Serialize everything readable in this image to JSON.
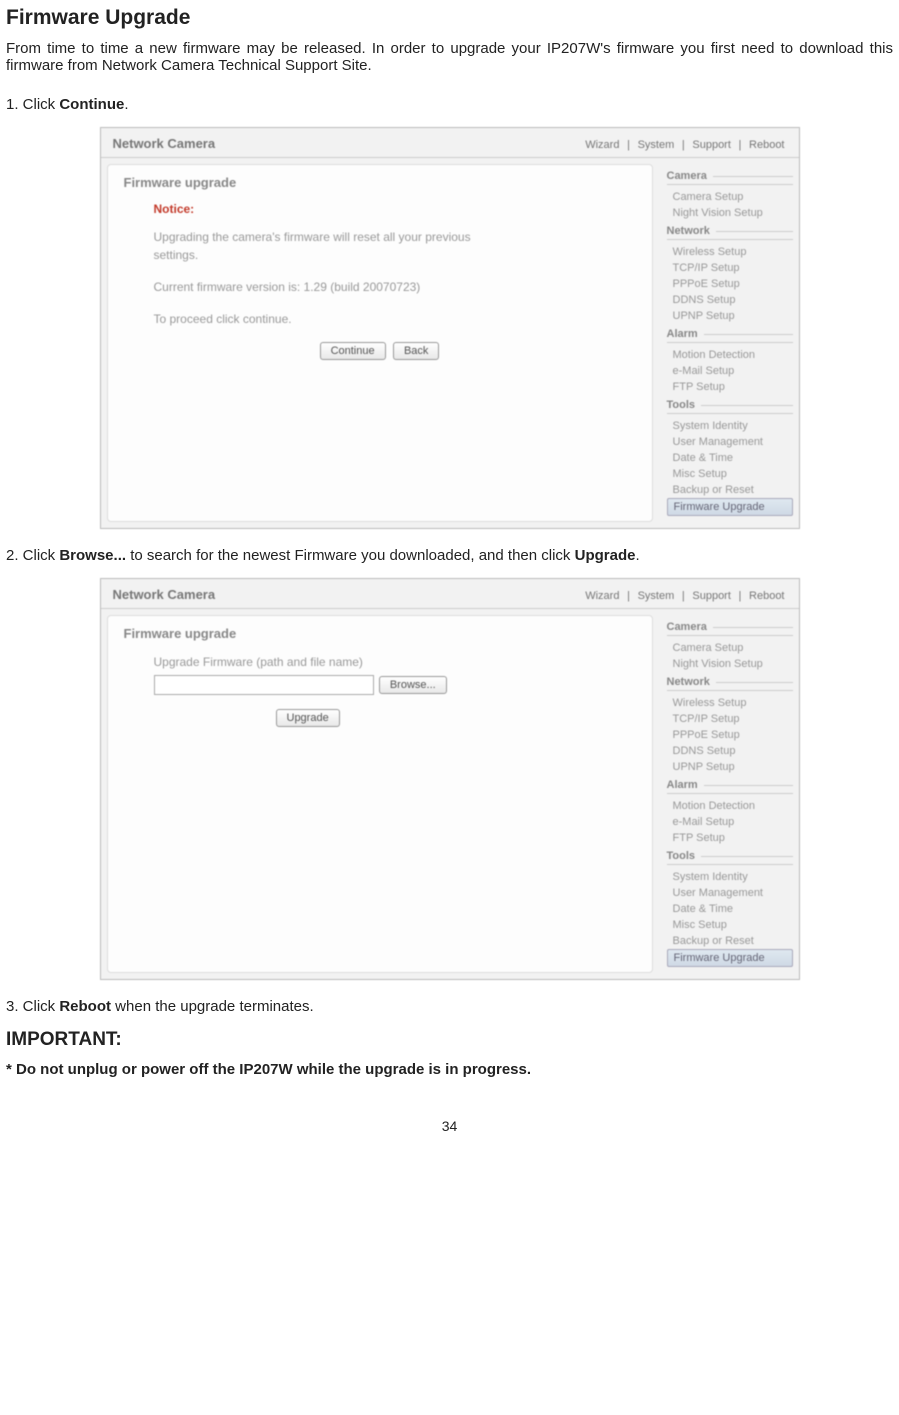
{
  "heading": "Firmware Upgrade",
  "intro": "From time to time a new firmware may be released. In order to upgrade your IP207W's firmware you first need to download this firmware from Network Camera Technical Support Site.",
  "step1_prefix": "1. Click ",
  "step1_bold": "Continue",
  "step1_suffix": ".",
  "step2_prefix": "2. Click ",
  "step2_bold1": "Browse...",
  "step2_mid": " to search for the newest Firmware you downloaded, and then click ",
  "step2_bold2": "Upgrade",
  "step2_suffix": ".",
  "step3_prefix": "3. Click ",
  "step3_bold": "Reboot",
  "step3_suffix": " when the upgrade terminates.",
  "important": "IMPORTANT:",
  "warning": "* Do not unplug or power off the IP207W while the upgrade is in progress.",
  "page_num": "34",
  "scr": {
    "title": "Network Camera",
    "toplinks": [
      "Wizard",
      "|",
      "System",
      "|",
      "Support",
      "|",
      "Reboot"
    ],
    "panel_title": "Firmware upgrade",
    "notice": "Notice:",
    "txt1": "Upgrading the camera's firmware will reset all your previous settings.",
    "txt2": "Current firmware version is: 1.29 (build 20070723)",
    "txt3": "To proceed click continue.",
    "btn_continue": "Continue",
    "btn_back": "Back",
    "upgrade_label": "Upgrade Firmware (path and file name)",
    "btn_browse": "Browse...",
    "btn_upgrade": "Upgrade",
    "side": {
      "camera": "Camera",
      "camera_items": [
        "Camera Setup",
        "Night Vision Setup"
      ],
      "network": "Network",
      "network_items": [
        "Wireless Setup",
        "TCP/IP Setup",
        "PPPoE Setup",
        "DDNS Setup",
        "UPNP Setup"
      ],
      "alarm": "Alarm",
      "alarm_items": [
        "Motion Detection",
        "e-Mail Setup",
        "FTP Setup"
      ],
      "tools": "Tools",
      "tools_items": [
        "System Identity",
        "User Management",
        "Date & Time",
        "Misc Setup",
        "Backup or Reset",
        "Firmware Upgrade"
      ]
    }
  }
}
